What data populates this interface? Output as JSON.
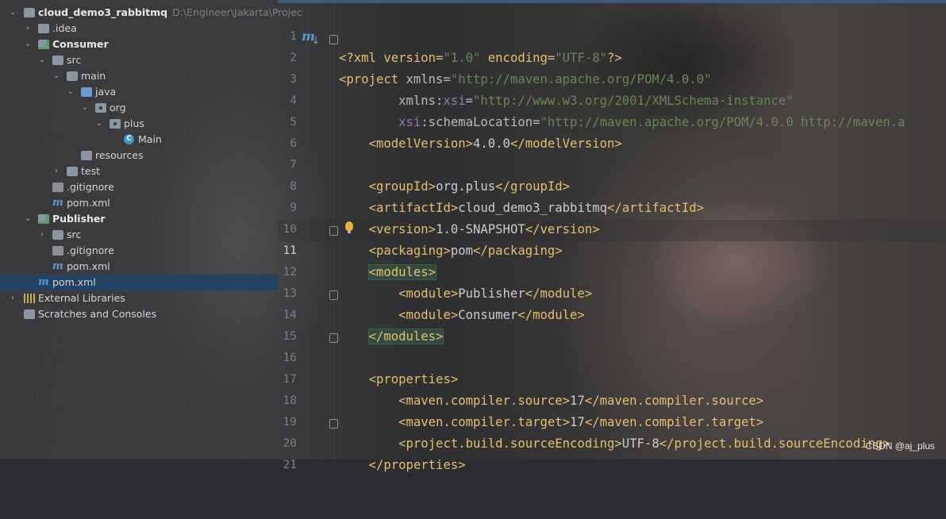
{
  "project_tree": {
    "root": {
      "name": "cloud_demo3_rabbitmq",
      "path": "D:\\Engineer\\Jakarta\\Projec"
    },
    "idea": ".idea",
    "consumer": "Consumer",
    "consumer_src": "src",
    "consumer_main": "main",
    "consumer_java": "java",
    "consumer_org": "org",
    "consumer_plus": "plus",
    "consumer_main_class": "Main",
    "consumer_resources": "resources",
    "consumer_test": "test",
    "consumer_gitignore": ".gitignore",
    "consumer_pom": "pom.xml",
    "publisher": "Publisher",
    "publisher_src": "src",
    "publisher_gitignore": ".gitignore",
    "publisher_pom": "pom.xml",
    "root_pom": "pom.xml",
    "external_libraries": "External Libraries",
    "scratches": "Scratches and Consoles"
  },
  "editor": {
    "current_line": 11,
    "line_numbers": [
      "1",
      "2",
      "3",
      "4",
      "5",
      "6",
      "7",
      "8",
      "9",
      "10",
      "11",
      "12",
      "13",
      "14",
      "15",
      "16",
      "17",
      "18",
      "19",
      "20",
      "21"
    ],
    "lines": [
      [
        "<?xml version=",
        "\"1.0\"",
        " encoding=",
        "\"UTF-8\"",
        "?>"
      ],
      [
        "<project ",
        "xmlns=",
        "\"http://maven.apache.org/POM/4.0.0\""
      ],
      [
        "        ",
        "xmlns:",
        "xsi",
        "=",
        "\"http://www.w3.org/2001/XMLSchema-instance\""
      ],
      [
        "        ",
        "xsi",
        ":schemaLocation=",
        "\"http://maven.apache.org/POM/4.0.0 http://maven.a"
      ],
      [
        "    ",
        "<modelVersion>",
        "4.0.0",
        "</modelVersion>"
      ],
      [
        ""
      ],
      [
        "    ",
        "<groupId>",
        "org.plus",
        "</groupId>"
      ],
      [
        "    ",
        "<artifactId>",
        "cloud_demo3_rabbitmq",
        "</artifactId>"
      ],
      [
        "    ",
        "<version>",
        "1.0-SNAPSHOT",
        "</version>"
      ],
      [
        "    ",
        "<packaging>",
        "pom",
        "</packaging>"
      ],
      [
        "    ",
        "<modules>"
      ],
      [
        "        ",
        "<module>",
        "Publisher",
        "</module>"
      ],
      [
        "        ",
        "<module>",
        "Consumer",
        "</module>"
      ],
      [
        "    ",
        "</modules>"
      ],
      [
        ""
      ],
      [
        "    ",
        "<properties>"
      ],
      [
        "        ",
        "<maven.compiler.source>",
        "17",
        "</maven.compiler.source>"
      ],
      [
        "        ",
        "<maven.compiler.target>",
        "17",
        "</maven.compiler.target>"
      ],
      [
        "        ",
        "<project.build.sourceEncoding>",
        "UTF-8",
        "</project.build.sourceEncoding>"
      ],
      [
        "    ",
        "</properties>"
      ],
      [
        ""
      ]
    ]
  },
  "icons": {
    "maven": "m",
    "class": "C"
  },
  "watermark": "CSDN @aj_plus"
}
